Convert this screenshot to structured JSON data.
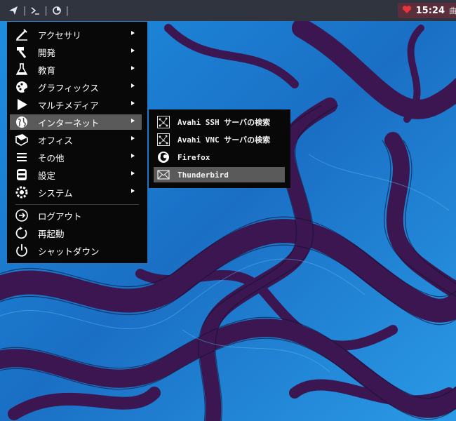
{
  "panel": {
    "separator": "|",
    "clock": "15:24",
    "calendar_text": "曲",
    "icons": [
      "launcher-icon",
      "terminal-icon",
      "app-icon",
      "heart-icon"
    ],
    "colors": {
      "panel_bg": "#2f343f",
      "heart": "#e8333c",
      "tray_bg": "#5a2e3a"
    }
  },
  "menu": {
    "items": [
      {
        "label": "アクセサリ",
        "icon": "accessories-icon",
        "submenu": true
      },
      {
        "label": "開発",
        "icon": "development-icon",
        "submenu": true
      },
      {
        "label": "教育",
        "icon": "education-icon",
        "submenu": true
      },
      {
        "label": "グラフィックス",
        "icon": "graphics-icon",
        "submenu": true
      },
      {
        "label": "マルチメディア",
        "icon": "multimedia-icon",
        "submenu": true
      },
      {
        "label": "インターネット",
        "icon": "internet-icon",
        "submenu": true,
        "active": true
      },
      {
        "label": "オフィス",
        "icon": "office-icon",
        "submenu": true
      },
      {
        "label": "その他",
        "icon": "other-icon",
        "submenu": true
      },
      {
        "label": "設定",
        "icon": "settings-icon",
        "submenu": true
      },
      {
        "label": "システム",
        "icon": "system-icon",
        "submenu": true
      }
    ],
    "session": [
      {
        "label": "ログアウト",
        "icon": "logout-icon"
      },
      {
        "label": "再起動",
        "icon": "restart-icon"
      },
      {
        "label": "シャットダウン",
        "icon": "shutdown-icon"
      }
    ]
  },
  "submenu": {
    "items": [
      {
        "label": "Avahi SSH サーバの検索",
        "icon": "network-icon"
      },
      {
        "label": "Avahi VNC サーバの検索",
        "icon": "network-icon"
      },
      {
        "label": "Firefox",
        "icon": "firefox-icon"
      },
      {
        "label": "Thunderbird",
        "icon": "mail-icon",
        "active": true
      }
    ]
  },
  "colors": {
    "wallpaper_blue": "#1f86d6",
    "wallpaper_purple": "#3a1a52",
    "menu_bg": "#080808",
    "highlight": "#5a5a5a"
  }
}
